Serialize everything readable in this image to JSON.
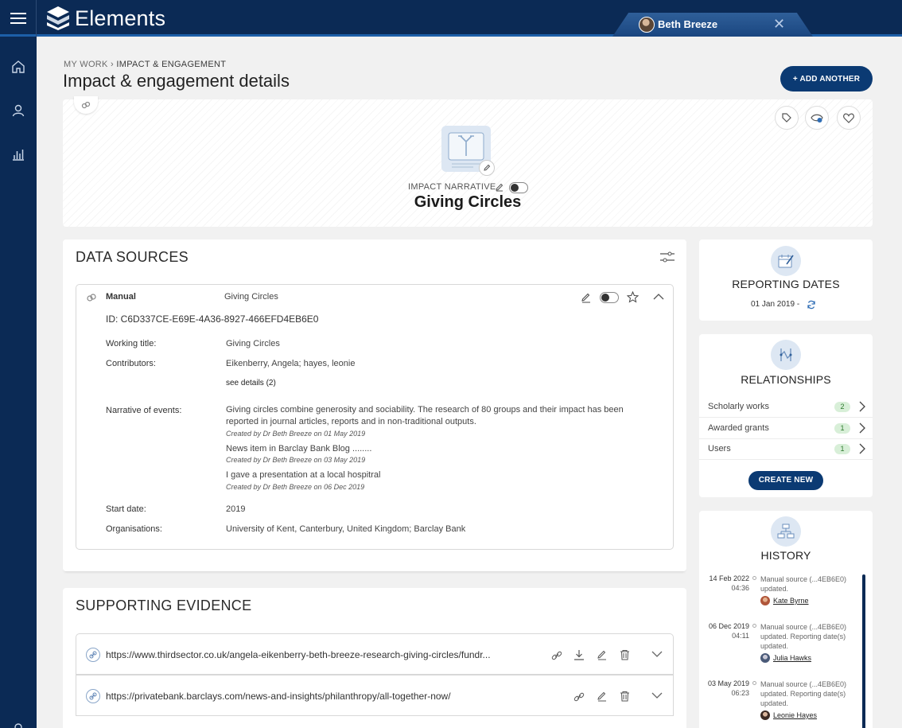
{
  "app": {
    "name": "Elements"
  },
  "user": {
    "name": "Beth Breeze"
  },
  "breadcrumb": {
    "root": "MY WORK",
    "separator": "›",
    "current": "IMPACT & ENGAGEMENT"
  },
  "page": {
    "title": "Impact & engagement details",
    "add_another": "+ ADD ANOTHER"
  },
  "hero": {
    "type_label": "IMPACT NARRATIVE",
    "name": "Giving Circles"
  },
  "data_sources": {
    "title": "DATA SOURCES",
    "source": {
      "type": "Manual",
      "title": "Giving Circles",
      "id": "ID: C6D337CE-E69E-4A36-8927-466EFD4EB6E0",
      "fields": {
        "working_title_label": "Working title:",
        "working_title": "Giving Circles",
        "contributors_label": "Contributors:",
        "contributors": "Eikenberry, Angela; hayes, leonie",
        "see_details": "see details (2)",
        "narrative_label": "Narrative of events:",
        "narrative_1_line1": "Giving circles combine generosity and sociability. The research of 80 groups and their impact has been",
        "narrative_1_line2": "reported in journal articles, reports and in non-traditional outputs.",
        "narrative_1_meta": "Created by Dr Beth Breeze on 01 May 2019",
        "narrative_2": "News item in Barclay Bank Blog ........",
        "narrative_2_meta": "Created by Dr Beth Breeze on 03 May 2019",
        "narrative_3": "I gave a presentation at a local hospitral",
        "narrative_3_meta": "Created by Dr Beth Breeze on 06 Dec 2019",
        "start_date_label": "Start date:",
        "start_date": "2019",
        "organisations_label": "Organisations:",
        "organisations": "University of Kent, Canterbury, United Kingdom; Barclay Bank"
      }
    }
  },
  "supporting_evidence": {
    "title": "SUPPORTING EVIDENCE",
    "items": [
      {
        "url": "https://www.thirdsector.co.uk/angela-eikenberry-beth-breeze-research-giving-circles/fundr..."
      },
      {
        "url": "https://privatebank.barclays.com/news-and-insights/philanthropy/all-together-now/"
      }
    ]
  },
  "reporting_dates": {
    "title": "REPORTING DATES",
    "value": "01 Jan 2019 -"
  },
  "relationships": {
    "title": "RELATIONSHIPS",
    "items": [
      {
        "label": "Scholarly works",
        "count": "2"
      },
      {
        "label": "Awarded grants",
        "count": "1"
      },
      {
        "label": "Users",
        "count": "1"
      }
    ],
    "create_new": "CREATE NEW"
  },
  "history": {
    "title": "HISTORY",
    "entries": [
      {
        "date": "14 Feb 2022",
        "time": "04:36",
        "line1": "Manual source (...4EB6E0)",
        "line2": "updated.",
        "line3": "",
        "user": "Kate Byrne"
      },
      {
        "date": "06 Dec 2019",
        "time": "04:11",
        "line1": "Manual source (...4EB6E0)",
        "line2": "updated. Reporting date(s)",
        "line3": "updated.",
        "user": "Julia Hawks"
      },
      {
        "date": "03 May 2019",
        "time": "06:23",
        "line1": "Manual source (...4EB6E0)",
        "line2": "updated. Reporting date(s)",
        "line3": "updated.",
        "user": "Leonie Hayes"
      }
    ]
  },
  "colors": {
    "navy": "#0b2a55",
    "button": "#0b3a73",
    "accent": "#1d5fa8",
    "count_badge": "#d8efd8"
  }
}
